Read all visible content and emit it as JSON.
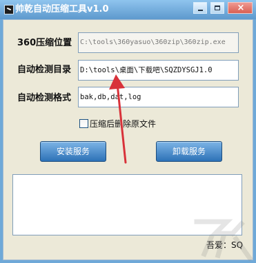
{
  "window": {
    "title": "帅乾自动压缩工具v1.0",
    "controls": {
      "minimize": "minimize",
      "maximize": "maximize",
      "close": "close",
      "close_glyph": "×"
    }
  },
  "form": {
    "compress_location_label": "360压缩位置",
    "compress_location_value": "C:\\tools\\360yasuo\\360zip\\360zip.exe",
    "watch_directory_label": "自动检测目录",
    "watch_directory_value": "D:\\tools\\桌面\\下载吧\\SQZDYSGJ1.0",
    "watch_formats_label": "自动检测格式",
    "watch_formats_value": "bak,db,dat,log",
    "delete_original_label": "压缩后删除原文件",
    "delete_original_checked": false
  },
  "buttons": {
    "install": "安装服务",
    "uninstall": "卸载服务"
  },
  "footer": {
    "author": "吾爱：SQ"
  },
  "annotation": {
    "color": "#d8323a"
  },
  "colors": {
    "titlebar_start": "#8fc4ee",
    "titlebar_end": "#5d99cd",
    "client_background": "#ece9d8",
    "button_start": "#7db4e6",
    "button_end": "#2d72b7"
  }
}
